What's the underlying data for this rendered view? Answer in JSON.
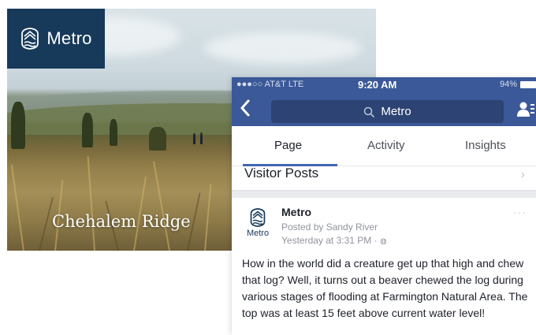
{
  "photo_card": {
    "logo_text": "Metro",
    "title": "Chehalem Ridge"
  },
  "phone": {
    "status_bar": {
      "carrier": "●●●○○ AT&T  LTE",
      "time": "9:20 AM",
      "battery": "94%"
    },
    "nav": {
      "search_value": "Metro"
    },
    "tabs": [
      {
        "label": "Page"
      },
      {
        "label": "Activity"
      },
      {
        "label": "Insights"
      }
    ],
    "section_title": "Visitor Posts",
    "post": {
      "avatar_label": "Metro",
      "author": "Metro",
      "posted_by": "Posted by Sandy River",
      "timestamp": "Yesterday at 3:31 PM ·",
      "body": "How in the world did a creature get up that high and chew that log? Well, it turns out a beaver chewed the log during various stages of flooding at Farmington Natural Area. The top was at least 15 feet above current water level!"
    }
  },
  "colors": {
    "metro_navy": "#173a5a",
    "facebook_blue": "#3b5998",
    "tab_indicator": "#4267b2"
  }
}
